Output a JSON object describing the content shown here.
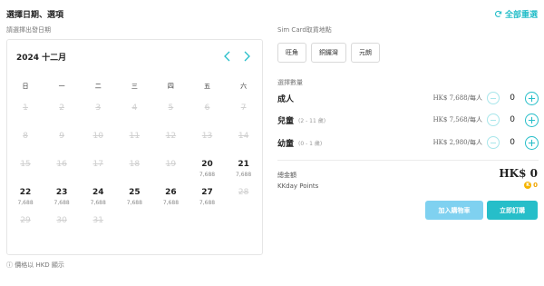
{
  "header": {
    "title": "選擇日期、選項",
    "reset_label": "全部重選"
  },
  "calendar": {
    "subtitle": "請選擇出發日期",
    "month_label": "2024 十二月",
    "weekdays": [
      "日",
      "一",
      "二",
      "三",
      "四",
      "五",
      "六"
    ],
    "weeks": [
      [
        {
          "day": "1",
          "price": "",
          "available": false
        },
        {
          "day": "2",
          "price": "",
          "available": false
        },
        {
          "day": "3",
          "price": "",
          "available": false
        },
        {
          "day": "4",
          "price": "",
          "available": false
        },
        {
          "day": "5",
          "price": "",
          "available": false
        },
        {
          "day": "6",
          "price": "",
          "available": false
        },
        {
          "day": "7",
          "price": "",
          "available": false
        }
      ],
      [
        {
          "day": "8",
          "price": "",
          "available": false
        },
        {
          "day": "9",
          "price": "",
          "available": false
        },
        {
          "day": "10",
          "price": "",
          "available": false
        },
        {
          "day": "11",
          "price": "",
          "available": false
        },
        {
          "day": "12",
          "price": "",
          "available": false
        },
        {
          "day": "13",
          "price": "",
          "available": false
        },
        {
          "day": "14",
          "price": "",
          "available": false
        }
      ],
      [
        {
          "day": "15",
          "price": "",
          "available": false
        },
        {
          "day": "16",
          "price": "",
          "available": false
        },
        {
          "day": "17",
          "price": "",
          "available": false
        },
        {
          "day": "18",
          "price": "",
          "available": false
        },
        {
          "day": "19",
          "price": "",
          "available": false
        },
        {
          "day": "20",
          "price": "7,688",
          "available": true
        },
        {
          "day": "21",
          "price": "7,688",
          "available": true
        }
      ],
      [
        {
          "day": "22",
          "price": "7,688",
          "available": true
        },
        {
          "day": "23",
          "price": "7,688",
          "available": true
        },
        {
          "day": "24",
          "price": "7,688",
          "available": true
        },
        {
          "day": "25",
          "price": "7,688",
          "available": true
        },
        {
          "day": "26",
          "price": "7,688",
          "available": true
        },
        {
          "day": "27",
          "price": "7,688",
          "available": true
        },
        {
          "day": "28",
          "price": "",
          "available": false
        }
      ],
      [
        {
          "day": "29",
          "price": "",
          "available": false
        },
        {
          "day": "30",
          "price": "",
          "available": false
        },
        {
          "day": "31",
          "price": "",
          "available": false
        }
      ]
    ],
    "footnote": "ⓘ 價格以 HKD 顯示"
  },
  "sim": {
    "label": "Sim Card取貨地點",
    "options": [
      "旺角",
      "銅鑼灣",
      "元朗"
    ]
  },
  "quantity": {
    "label": "選擇數量",
    "rows": [
      {
        "name": "成人",
        "sub": "",
        "price": "HK$ 7,688/每人",
        "count": "0"
      },
      {
        "name": "兒童",
        "sub": "(2 - 11 歲)",
        "price": "HK$ 7,568/每人",
        "count": "0"
      },
      {
        "name": "幼童",
        "sub": "(0 - 1 歲)",
        "price": "HK$ 2,980/每人",
        "count": "0"
      }
    ]
  },
  "summary": {
    "total_label": "總金額",
    "total_value": "HK$ 0",
    "points_label": "KKday Points",
    "points_value": "0"
  },
  "actions": {
    "add_to_cart": "加入購物車",
    "book_now": "立即訂購"
  },
  "colors": {
    "accent": "#26bec9",
    "cart": "#7fd1f0",
    "points": "#f0a500"
  }
}
